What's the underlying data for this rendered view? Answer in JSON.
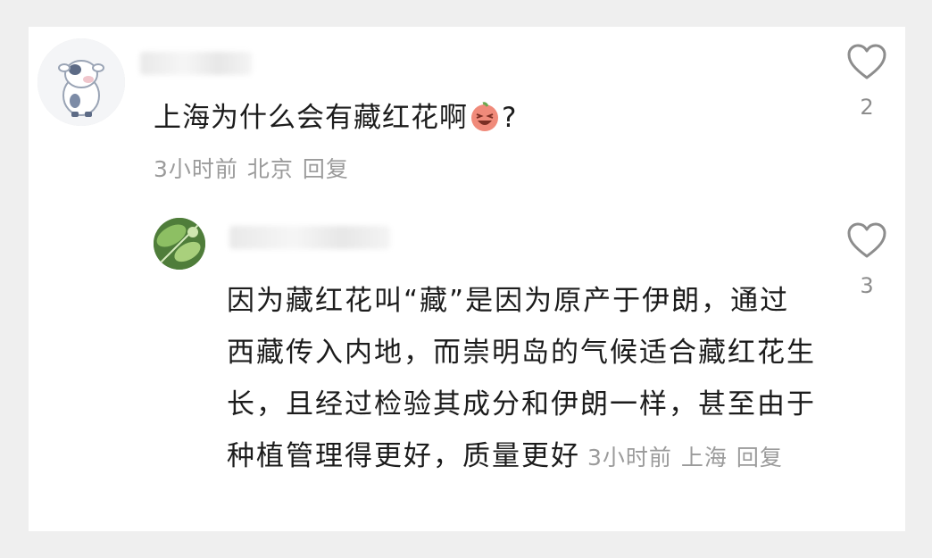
{
  "comment": {
    "text": "上海为什么会有藏红花啊",
    "suffix": "?",
    "time": "3小时前",
    "location": "北京",
    "reply_label": "回复",
    "like_count": "2",
    "emoji_icon": "laughing-face-emoji"
  },
  "reply": {
    "text": "因为藏红花叫“藏”是因为原产于伊朗，通过西藏传入内地，而崇明岛的气候适合藏红花生长，且经过检验其成分和伊朗一样，甚至由于种植管理得更好，质量更好",
    "time": "3小时前",
    "location": "上海",
    "reply_label": "回复",
    "like_count": "3"
  },
  "colors": {
    "text": "#1c1c1c",
    "meta": "#9b9b9b",
    "icon": "#8d8d8d"
  }
}
